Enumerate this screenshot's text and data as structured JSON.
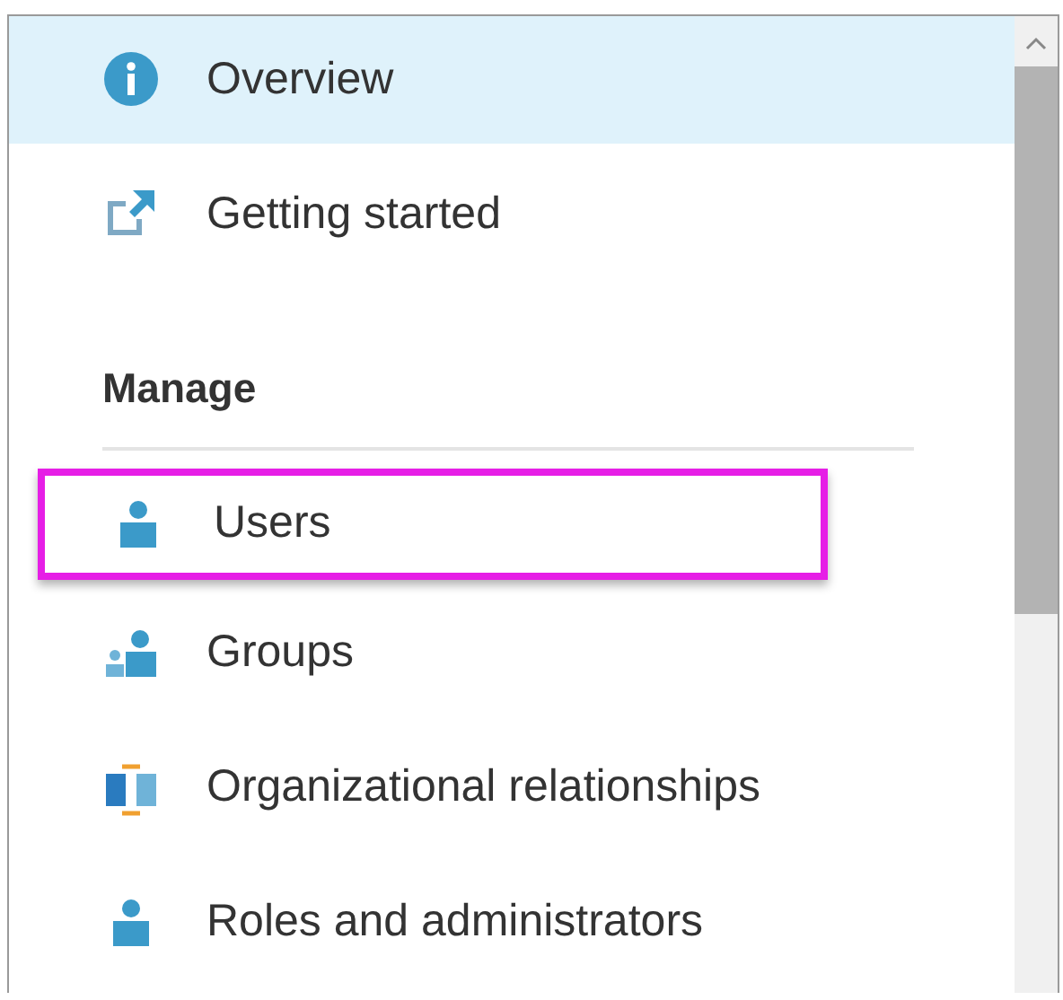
{
  "nav": {
    "top_items": [
      {
        "label": "Overview",
        "kind": "info",
        "selected": true,
        "outlined": false
      },
      {
        "label": "Getting started",
        "kind": "start",
        "selected": false,
        "outlined": false
      }
    ],
    "section": {
      "heading": "Manage",
      "items": [
        {
          "label": "Users",
          "kind": "user",
          "selected": false,
          "outlined": true
        },
        {
          "label": "Groups",
          "kind": "group",
          "selected": false,
          "outlined": false
        },
        {
          "label": "Organizational relationships",
          "kind": "org",
          "selected": false,
          "outlined": false
        },
        {
          "label": "Roles and administrators",
          "kind": "user",
          "selected": false,
          "outlined": false
        }
      ]
    }
  }
}
